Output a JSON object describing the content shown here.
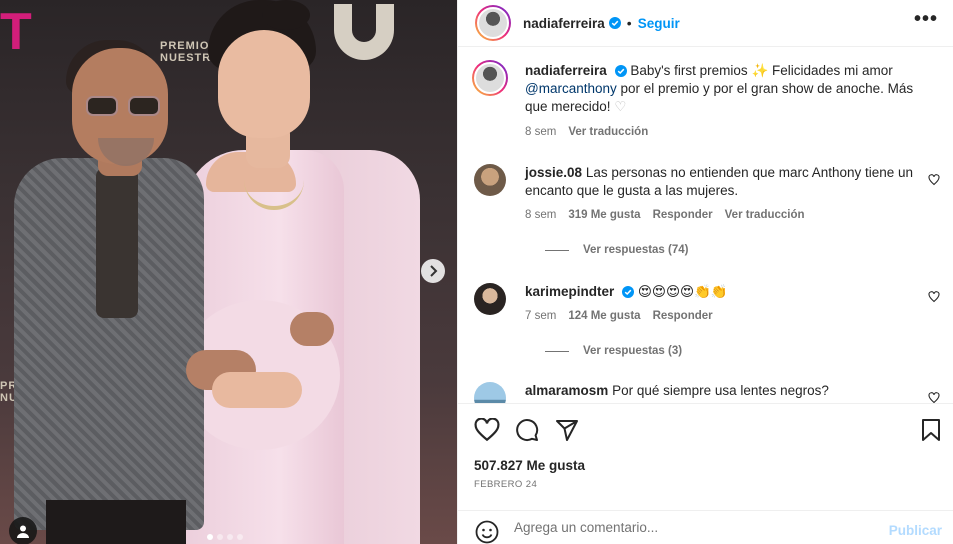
{
  "post": {
    "author": "nadiaferreira",
    "follow_label": "Seguir",
    "more_label": "•••",
    "caption_user": "nadiaferreira",
    "caption_text_1": " Baby's first premios ",
    "caption_text_2": " Felicidades mi amor",
    "caption_mention": "@marcanthony",
    "caption_text_3": " por el premio y por el gran show de anoche. Más que merecido! ",
    "caption_time": "8 sem",
    "caption_translate": "Ver traducción",
    "likes": "507.827 Me gusta",
    "date": "FEBRERO 24"
  },
  "comments": [
    {
      "user": "jossie.08",
      "text": "Las personas no entienden que marc Anthony tiene un encanto que le gusta a las mujeres.",
      "time": "8 sem",
      "likes": "319 Me gusta",
      "reply": "Responder",
      "translate": "Ver traducción",
      "replies": "Ver respuestas (74)"
    },
    {
      "user": "karimepindter",
      "text": "😍😍😍😍👏👏",
      "time": "7 sem",
      "likes": "124 Me gusta",
      "reply": "Responder",
      "replies": "Ver respuestas (3)"
    },
    {
      "user": "almaramosm",
      "text": "Por qué siempre usa lentes negros?"
    }
  ],
  "add_comment": {
    "placeholder": "Agrega un comentario...",
    "publish_label": "Publicar"
  },
  "photo": {
    "logo_text": "PREMIO NUESTRO",
    "carousel_total": 4,
    "carousel_active": 1
  },
  "colors": {
    "accent": "#0095f6",
    "verified": "#0095f6",
    "link": "#00376b",
    "muted": "#737373",
    "publish_disabled": "#b3dbff"
  }
}
